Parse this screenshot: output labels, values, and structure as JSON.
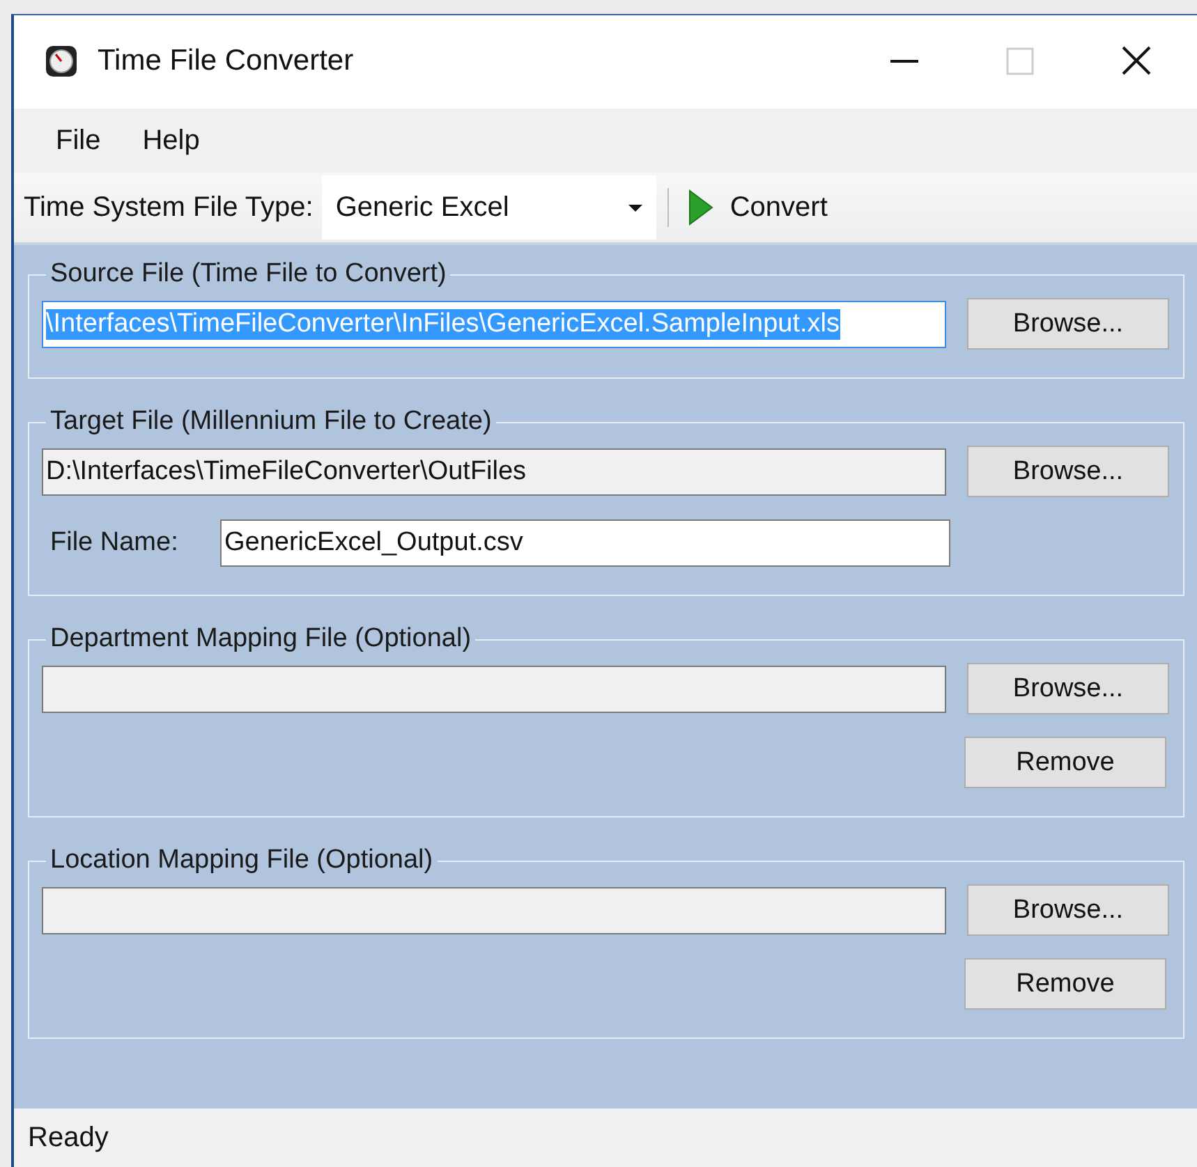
{
  "window": {
    "title": "Time File Converter"
  },
  "menu": [
    {
      "label": "File"
    },
    {
      "label": "Help"
    }
  ],
  "toolbar": {
    "type_label": "Time System File Type:",
    "file_type": "Generic Excel",
    "convert_button": "Convert"
  },
  "groups": [
    {
      "title": "Source File (Time File to Convert)",
      "path": {
        "value": "\\Interfaces\\TimeFileConverter\\InFiles\\GenericExcel.SampleInput.xls",
        "text_selected": true
      },
      "browse_button": "Browse..."
    },
    {
      "title": "Target File (Millennium File to Create)",
      "path": {
        "value": "D:\\Interfaces\\TimeFileConverter\\OutFiles",
        "text_selected": false
      },
      "browse_button": "Browse...",
      "file_name": {
        "label": "File Name:",
        "value": "GenericExcel_Output.csv"
      }
    },
    {
      "title": "Department Mapping File (Optional)",
      "path": {
        "text_selected": false
      },
      "browse_button": "Browse...",
      "remove_button": "Remove"
    },
    {
      "title": "Location Mapping File (Optional)",
      "path": {
        "text_selected": false
      },
      "browse_button": "Browse...",
      "remove_button": "Remove"
    }
  ],
  "status_bar": {
    "text": "Ready"
  }
}
